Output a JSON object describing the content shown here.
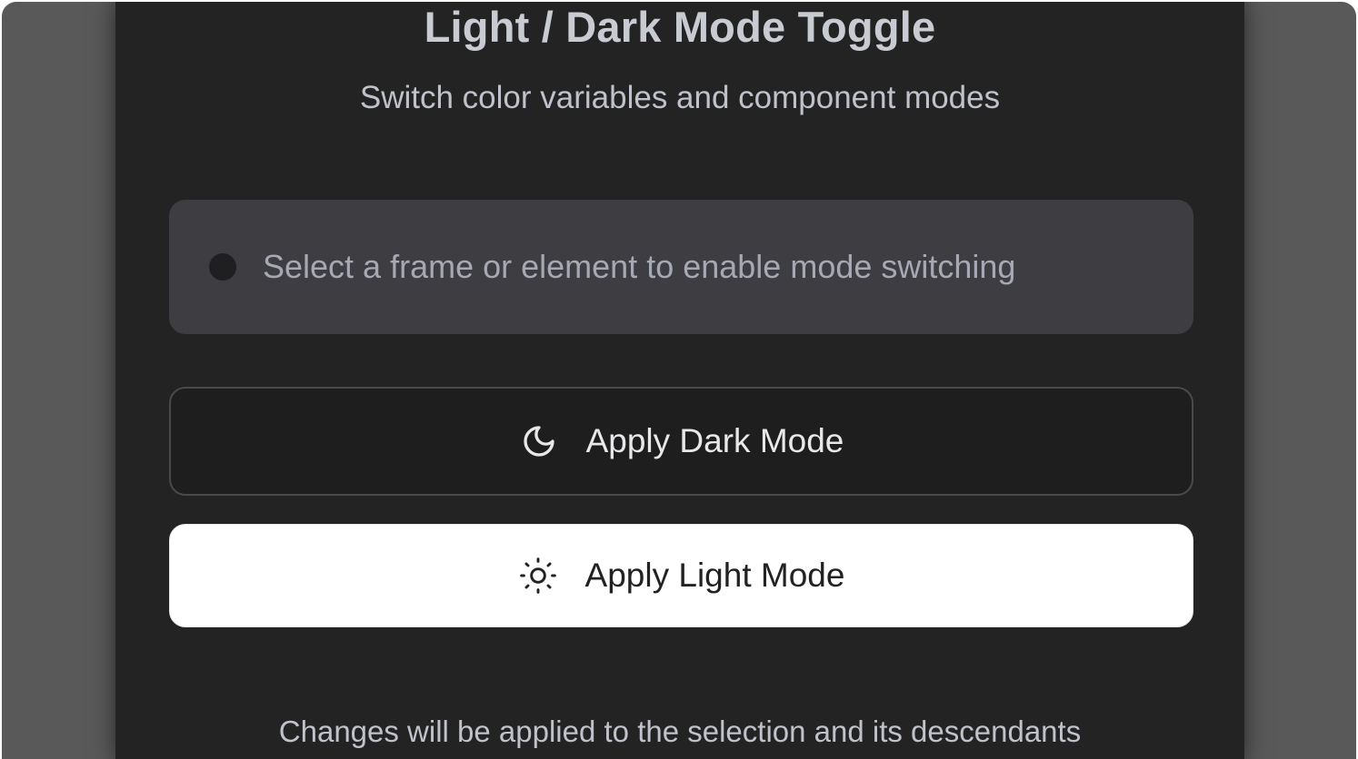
{
  "header": {
    "title": "Light / Dark Mode Toggle",
    "subtitle": "Switch color variables and component modes"
  },
  "status": {
    "message": "Select a frame or element to enable mode switching",
    "indicator": "inactive"
  },
  "actions": {
    "dark": {
      "label": "Apply Dark Mode",
      "icon": "moon-icon"
    },
    "light": {
      "label": "Apply Light Mode",
      "icon": "sun-icon"
    }
  },
  "footer": {
    "note": "Changes will be applied to the selection and its descendants"
  },
  "colors": {
    "panel_background": "#232323",
    "outer_background": "#595959",
    "status_box": "#3d3d42",
    "light_button": "#ffffff"
  }
}
